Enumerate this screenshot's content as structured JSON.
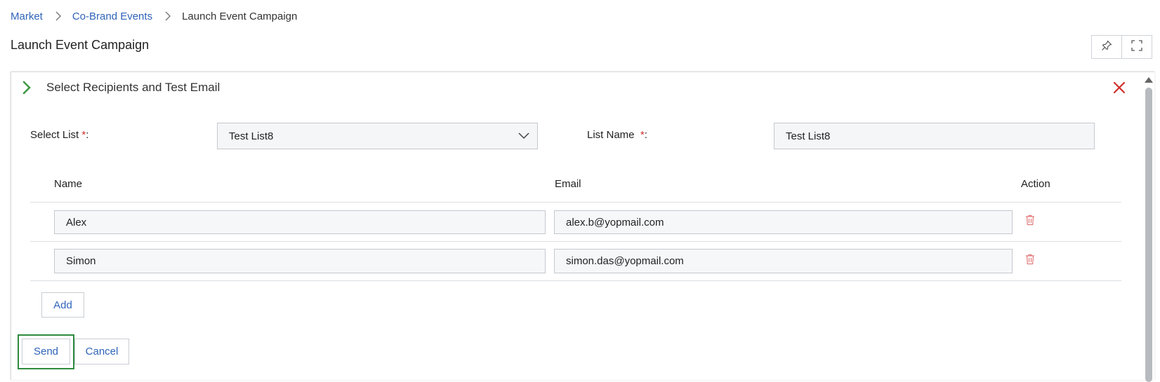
{
  "breadcrumb": {
    "items": [
      "Market",
      "Co-Brand Events"
    ],
    "current": "Launch Event Campaign"
  },
  "page_title": "Launch Event Campaign",
  "toolbar": {
    "pin_icon": "pin-icon",
    "fullscreen_icon": "fullscreen-icon"
  },
  "panel": {
    "title": "Select Recipients and Test Email",
    "expand_icon": "chevron-right-icon",
    "close_icon": "close-icon",
    "select_list": {
      "label": "Select List",
      "required_mark": "*",
      "colon": ":",
      "value": "Test List8"
    },
    "list_name": {
      "label": "List Name",
      "required_mark": "*",
      "colon": ":",
      "value": "Test List8"
    },
    "table": {
      "headers": {
        "name": "Name",
        "email": "Email",
        "action": "Action"
      },
      "rows": [
        {
          "name": "Alex",
          "email": "alex.b@yopmail.com"
        },
        {
          "name": "Simon",
          "email": "simon.das@yopmail.com"
        }
      ]
    },
    "add_label": "Add",
    "send_label": "Send",
    "cancel_label": "Cancel"
  },
  "colors": {
    "link": "#2f64b8",
    "chevron": "#3f9a45",
    "close": "#d0312d",
    "delete": "#e07b7b",
    "send_highlight": "#2e8b3e"
  }
}
